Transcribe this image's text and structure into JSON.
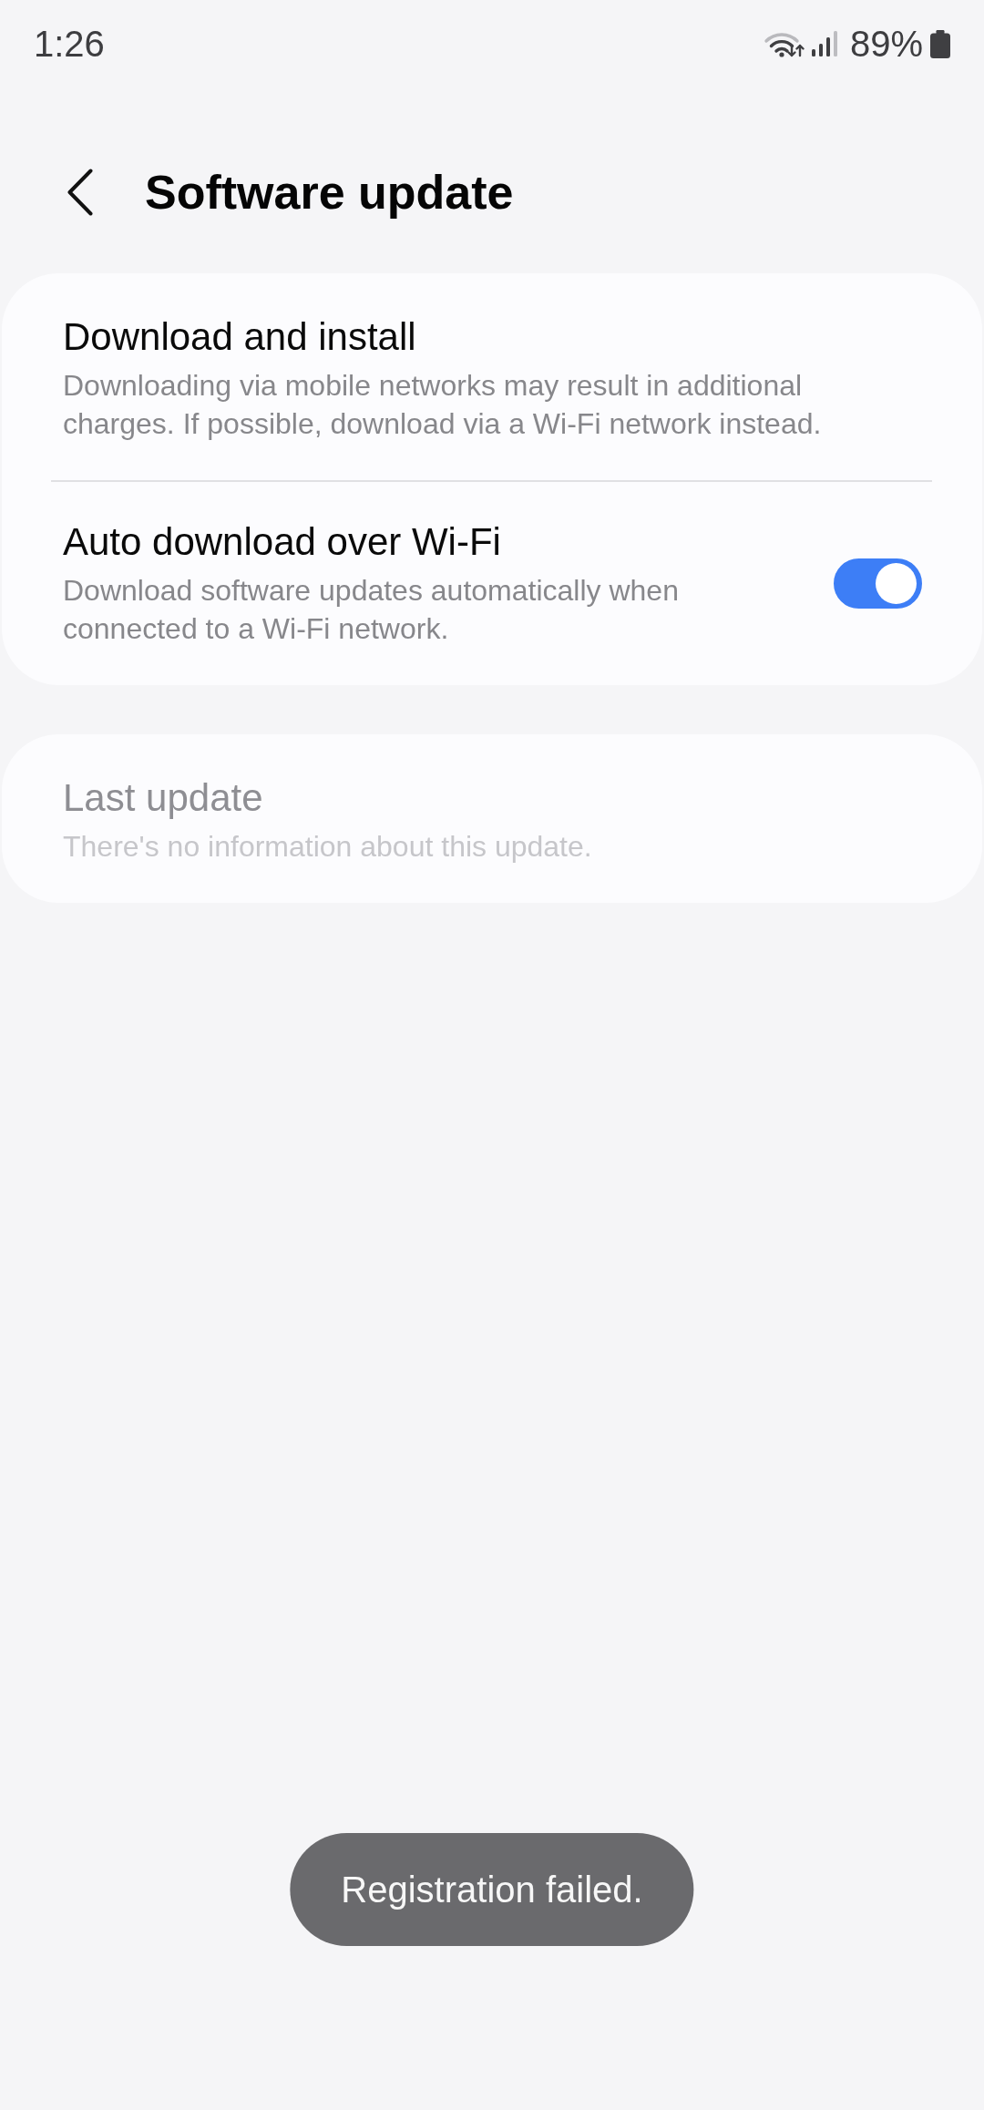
{
  "status_bar": {
    "time": "1:26",
    "battery": "89%"
  },
  "header": {
    "title": "Software update"
  },
  "cards": [
    {
      "items": [
        {
          "kind": "text",
          "title": "Download and install",
          "subtitle": "Downloading via mobile networks may result in additional charges. If possible, download via a Wi-Fi network instead.",
          "disabled": false
        },
        {
          "kind": "switch",
          "title": "Auto download over Wi-Fi",
          "subtitle": "Download software updates automatically when connected to a Wi-Fi network.",
          "disabled": false,
          "on": true
        }
      ]
    },
    {
      "items": [
        {
          "kind": "text",
          "title": "Last update",
          "subtitle": "There's no information about this update.",
          "disabled": true
        }
      ]
    }
  ],
  "toast": {
    "text": "Registration failed."
  }
}
